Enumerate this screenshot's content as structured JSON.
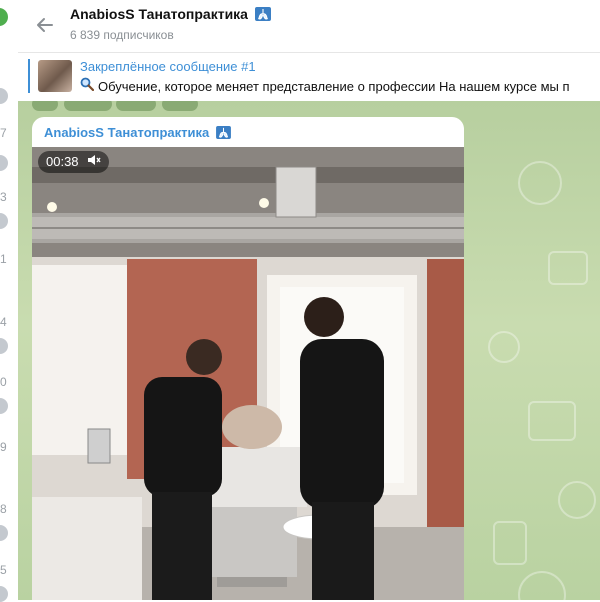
{
  "channel": {
    "title": "AnabiosS Танатопрактика",
    "subtitle": "6 839 подписчиков"
  },
  "pinned": {
    "title": "Закреплённое сообщение #1",
    "text": "Обучение, которое меняет представление о профессии На нашем курсе мы п"
  },
  "message": {
    "author": "AnabiosS Танатопрактика",
    "video_duration": "00:38"
  },
  "sidebar_counts": [
    "7",
    "3",
    "1",
    "4",
    "0",
    "9",
    "8",
    "5"
  ],
  "icons": {
    "back": "arrow-left-icon",
    "lungs": "lungs-emoji-icon",
    "search": "magnifier-emoji-icon",
    "mute": "speaker-muted-icon"
  },
  "colors": {
    "accent": "#3e8fd6",
    "chat_bg": "#c2d8aa",
    "secondary_text": "#8a8f94"
  }
}
